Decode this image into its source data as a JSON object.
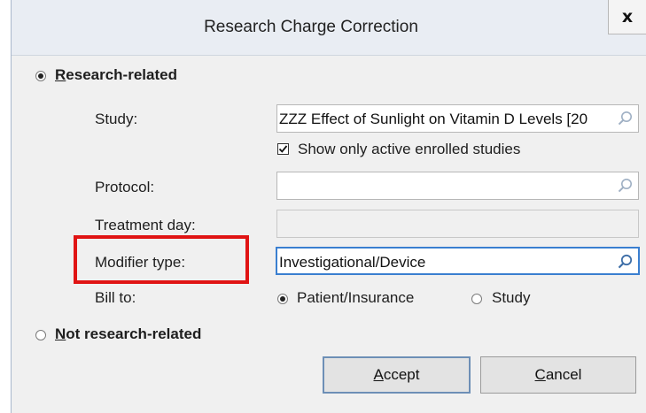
{
  "window": {
    "title": "Research Charge Correction",
    "close_label": "x"
  },
  "research_related": {
    "label": "Research-related",
    "selected": true,
    "study": {
      "label": "Study:",
      "value": "ZZZ Effect of Sunlight on Vitamin D Levels [20"
    },
    "show_active": {
      "label": "Show only active enrolled studies",
      "checked": true
    },
    "protocol": {
      "label": "Protocol:",
      "value": ""
    },
    "treatment_day": {
      "label": "Treatment day:",
      "value": ""
    },
    "modifier_type": {
      "label": "Modifier type:",
      "value": "Investigational/Device"
    },
    "bill_to": {
      "label": "Bill to:",
      "options": [
        {
          "label": "Patient/Insurance",
          "selected": true
        },
        {
          "label": "Study",
          "selected": false
        }
      ]
    }
  },
  "not_research_related": {
    "label": "Not research-related",
    "selected": false
  },
  "buttons": {
    "accept": "Accept",
    "cancel": "Cancel"
  },
  "colors": {
    "highlight": "#e01414",
    "active_field_border": "#3a7fd0"
  },
  "icons": {
    "field_lookup": "magnifier-icon",
    "close": "close-icon",
    "checkbox_check": "checkmark-icon"
  }
}
